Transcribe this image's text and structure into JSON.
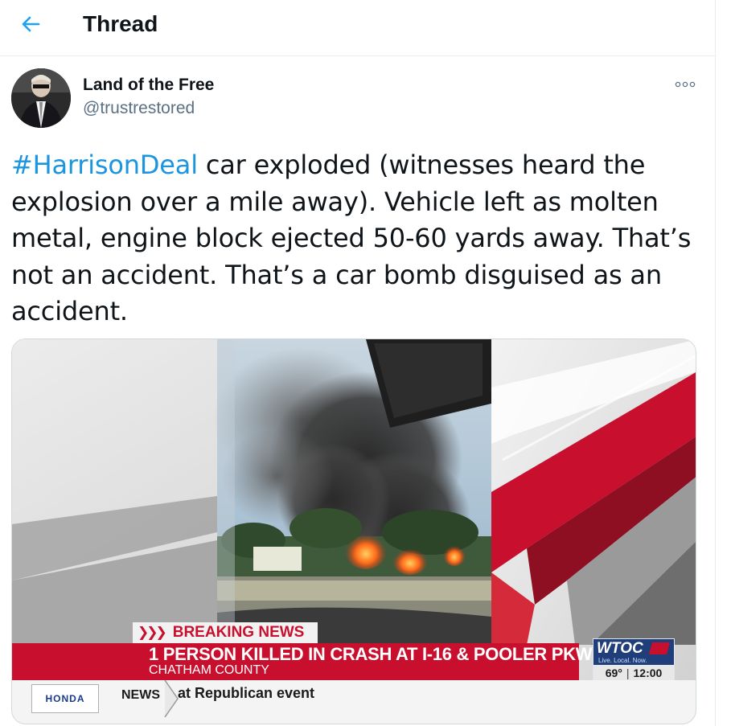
{
  "header": {
    "title": "Thread",
    "back_icon": "arrow-left-icon"
  },
  "tweet": {
    "author": {
      "display_name": "Land of the Free",
      "handle": "@trustrestored"
    },
    "more_icon": "more-options-icon",
    "hashtag": "#HarrisonDeal",
    "text": " car exploded (witnesses heard the explosion over a mile away).  Vehicle left as molten metal, engine block ejected 50-60 yards away.  That’s not an accident. That’s a car bomb disguised as an accident."
  },
  "media": {
    "breaking_arrows": "❯❯❯",
    "breaking_label": "BREAKING NEWS",
    "headline": "1 PERSON KILLED IN CRASH AT I-16 & POOLER PKWY",
    "subhead": "CHATHAM COUNTY",
    "station": {
      "logo": "WTOC",
      "tagline": "Live. Local. Now.",
      "temperature": "69°",
      "time": "12:00"
    },
    "ticker": {
      "sponsor": "HONDA",
      "label": "NEWS",
      "text": "at Republican event"
    }
  },
  "colors": {
    "hashtag": "#1b95e0",
    "accent": "#1da1f2",
    "news_red": "#c8102e",
    "station_blue": "#1f3e7a"
  }
}
